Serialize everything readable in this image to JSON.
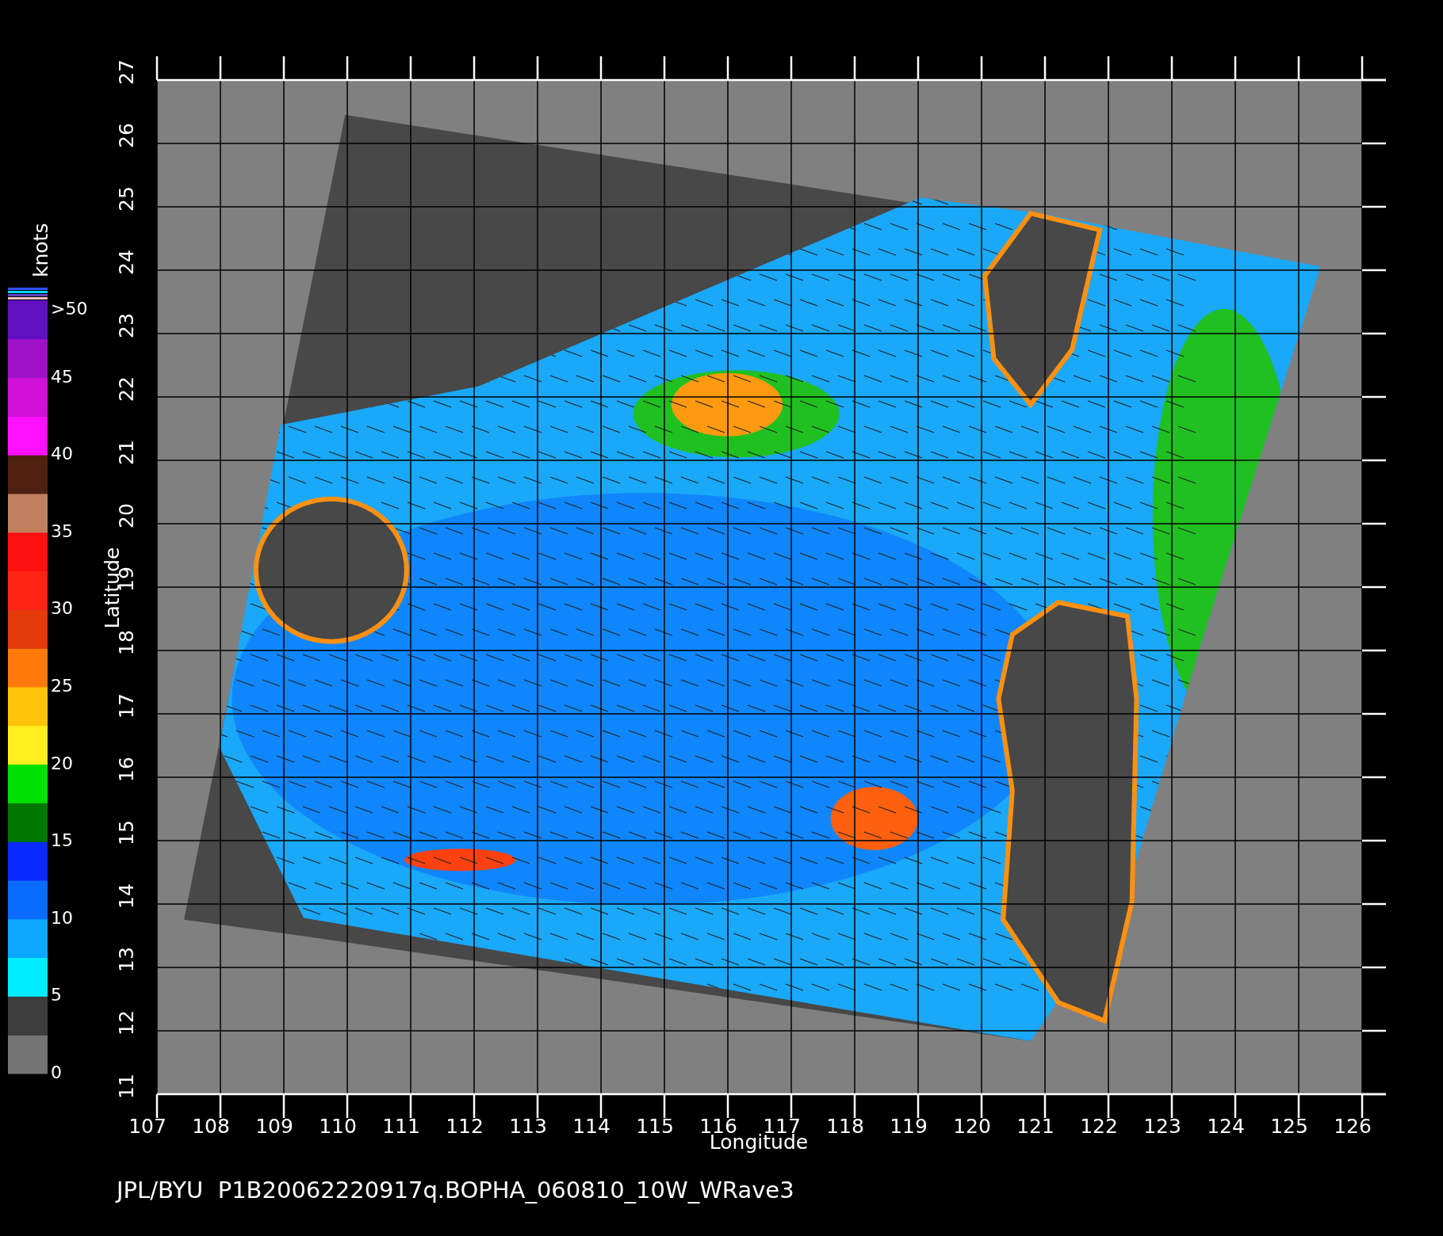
{
  "plot": {
    "xlabel": "Longitude",
    "ylabel": "Latitude",
    "xticks": [
      "107",
      "108",
      "109",
      "110",
      "111",
      "112",
      "113",
      "114",
      "115",
      "116",
      "117",
      "118",
      "119",
      "120",
      "121",
      "122",
      "123",
      "124",
      "125",
      "126"
    ],
    "yticks": [
      "11",
      "12",
      "13",
      "14",
      "15",
      "16",
      "17",
      "18",
      "19",
      "20",
      "21",
      "22",
      "23",
      "24",
      "25",
      "26",
      "27"
    ]
  },
  "colorbar": {
    "unit": "knots",
    "labels": [
      ">50",
      "45",
      "40",
      "35",
      "30",
      "25",
      "20",
      "15",
      "10",
      "5",
      "0"
    ],
    "segments": [
      {
        "color": "#747474"
      },
      {
        "color": "#3c3c3c"
      },
      {
        "color": "#00ecff"
      },
      {
        "color": "#0aa8ff"
      },
      {
        "color": "#0a6cff"
      },
      {
        "color": "#0a2aff"
      },
      {
        "color": "#007800"
      },
      {
        "color": "#00e000"
      },
      {
        "color": "#ffee20"
      },
      {
        "color": "#ffc40a"
      },
      {
        "color": "#ff7a0a"
      },
      {
        "color": "#e43a0a"
      },
      {
        "color": "#ff2414"
      },
      {
        "color": "#ff1010"
      },
      {
        "color": "#c08060"
      },
      {
        "color": "#502010"
      },
      {
        "color": "#ff10ff"
      },
      {
        "color": "#d010d8"
      },
      {
        "color": "#a010c8"
      },
      {
        "color": "#6010c0"
      }
    ],
    "top_stripes": [
      {
        "color": "#ffc0c0"
      },
      {
        "color": "#6040c0"
      },
      {
        "color": "#00d8ff"
      },
      {
        "color": "#3050ff"
      }
    ]
  },
  "footer": "JPL/BYU  P1B20062220917q.BOPHA_060810_10W_WRave3"
}
